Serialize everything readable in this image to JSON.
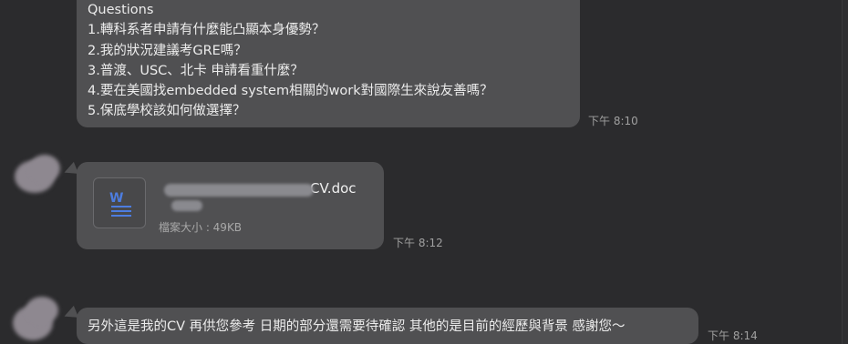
{
  "messages": {
    "questions": {
      "lines": [
        "Questions",
        "1.轉科系者申請有什麼能凸顯本身優勢？",
        "2.我的狀況建議考GRE嗎？",
        "3.普渡、USC、北卡 申請看重什麼？",
        "4.要在美國找embedded system相關的work對國際生來說友善嗎？",
        "5.保底學校該如何做選擇？"
      ],
      "time": "下午 8:10"
    },
    "file": {
      "icon": "word-document-icon",
      "name": "CV.doc",
      "size": "檔案大小 : 49KB",
      "time": "下午 8:12"
    },
    "note": {
      "text": "另外這是我的CV 再供您參考 日期的部分還需要待確認 其他的是目前的經歷與背景 感謝您〜",
      "time": "下午 8:14"
    }
  },
  "colors": {
    "background": "#2b2b2d",
    "bubble": "#505052",
    "accent_word": "#4d7de0"
  }
}
